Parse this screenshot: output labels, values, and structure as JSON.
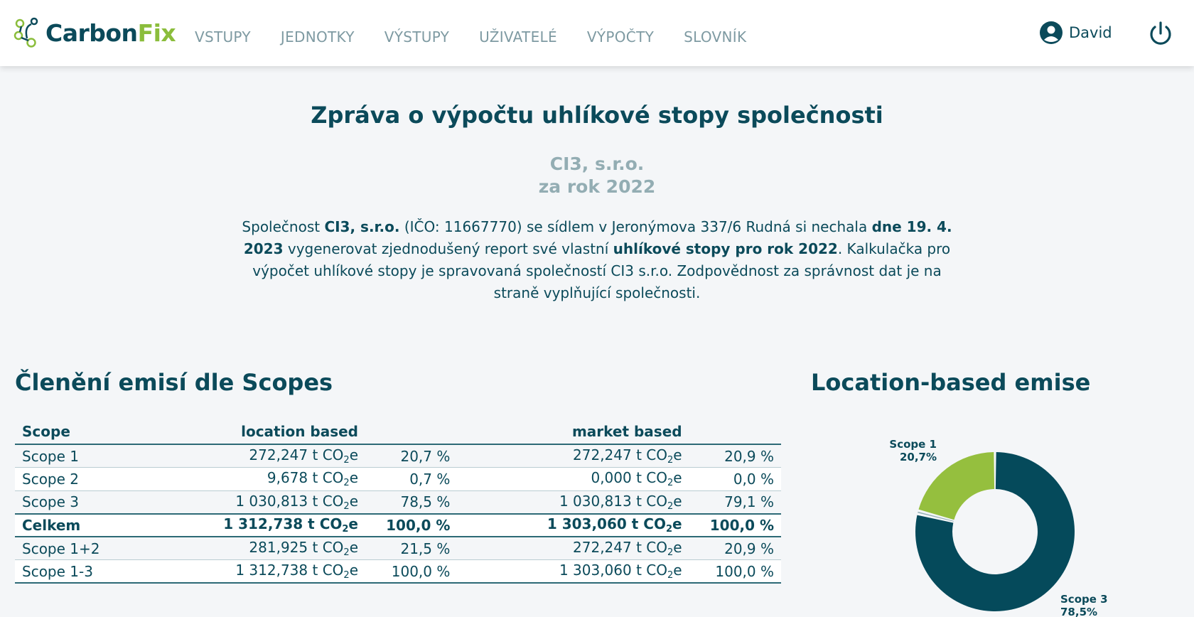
{
  "header": {
    "brand_part1": "Carbon",
    "brand_part2": "Fix",
    "nav": [
      "VSTUPY",
      "JEDNOTKY",
      "VÝSTUPY",
      "UŽIVATELÉ",
      "VÝPOČTY",
      "SLOVNÍK"
    ],
    "user_name": "David"
  },
  "report": {
    "title": "Zpráva o výpočtu uhlíkové stopy společnosti",
    "company": "CI3, s.r.o.",
    "year_line": "za rok 2022",
    "intro": {
      "p1": "Společnost ",
      "company_bold": "CI3, s.r.o.",
      "p2": " (IČO: 11667770) se sídlem v Jeronýmova 337/6 Rudná si nechala ",
      "date_bold": "dne 19. 4. 2023",
      "p3": " vygenerovat zjednodušený report své vlastní ",
      "footprint_bold": "uhlíkové stopy pro rok 2022",
      "p4": ". Kalkulačka pro výpočet uhlíkové stopy je spravovaná společností CI3 s.r.o. Zodpovědnost za správnost dat je na straně vyplňující společnosti."
    }
  },
  "scopes_section": {
    "title": "Členění emisí dle Scopes",
    "headers": {
      "scope": "Scope",
      "location": "location based",
      "market": "market based"
    },
    "unit_prefix": " t CO",
    "unit_sub": "2",
    "unit_suffix": "e",
    "rows": [
      {
        "scope": "Scope 1",
        "loc": "272,247",
        "loc_pct": "20,7 %",
        "mkt": "272,247",
        "mkt_pct": "20,9 %"
      },
      {
        "scope": "Scope 2",
        "loc": "9,678",
        "loc_pct": "0,7 %",
        "mkt": "0,000",
        "mkt_pct": "0,0 %"
      },
      {
        "scope": "Scope 3",
        "loc": "1 030,813",
        "loc_pct": "78,5 %",
        "mkt": "1 030,813",
        "mkt_pct": "79,1 %"
      },
      {
        "scope": "Celkem",
        "loc": "1 312,738",
        "loc_pct": "100,0 %",
        "mkt": "1 303,060",
        "mkt_pct": "100,0 %"
      },
      {
        "scope": "Scope 1+2",
        "loc": "281,925",
        "loc_pct": "21,5 %",
        "mkt": "272,247",
        "mkt_pct": "20,9 %"
      },
      {
        "scope": "Scope 1-3",
        "loc": "1 312,738",
        "loc_pct": "100,0 %",
        "mkt": "1 303,060",
        "mkt_pct": "100,0 %"
      }
    ]
  },
  "chart_section": {
    "title": "Location-based emise"
  },
  "chart_data": {
    "type": "pie",
    "variant": "donut",
    "title": "Location-based emise",
    "categories": [
      "Scope 1",
      "Scope 2",
      "Scope 3"
    ],
    "values": [
      20.7,
      0.7,
      78.5
    ],
    "labels": [
      {
        "name": "Scope 1",
        "value": "20,7%"
      },
      {
        "name": "Scope 3",
        "value": "78,5%"
      }
    ],
    "colors": [
      "#95bf3e",
      "#93adb3",
      "#054a5b"
    ]
  }
}
